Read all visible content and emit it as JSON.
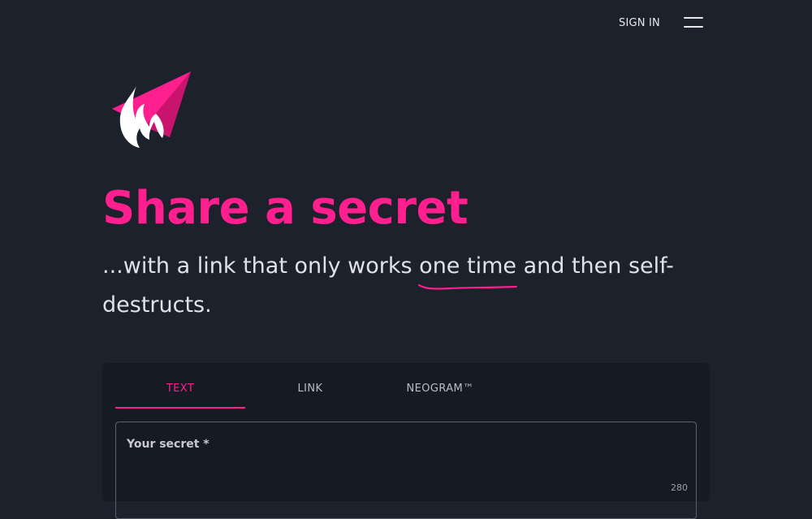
{
  "header": {
    "signin_label": "SIGN IN",
    "menu_icon": "hamburger-menu-icon"
  },
  "logo": {
    "icon": "flame-paper-plane-logo",
    "accent_color": "#ff1f8e",
    "flame_color": "#ffffff"
  },
  "hero": {
    "title": "Share a secret",
    "subtitle_before": "...with a link that only works ",
    "subtitle_emphasis": "one time",
    "subtitle_after": " and then self-destructs."
  },
  "tabs": [
    {
      "label": "TEXT",
      "active": true
    },
    {
      "label": "LINK",
      "active": false
    },
    {
      "label": "NEOGRAM™",
      "active": false
    }
  ],
  "secret_form": {
    "label": "Your secret *",
    "value": "",
    "char_counter": "280"
  },
  "colors": {
    "background": "#1c212b",
    "card": "#161a22",
    "accent": "#ff1f8e",
    "text": "#dfe2ea"
  }
}
